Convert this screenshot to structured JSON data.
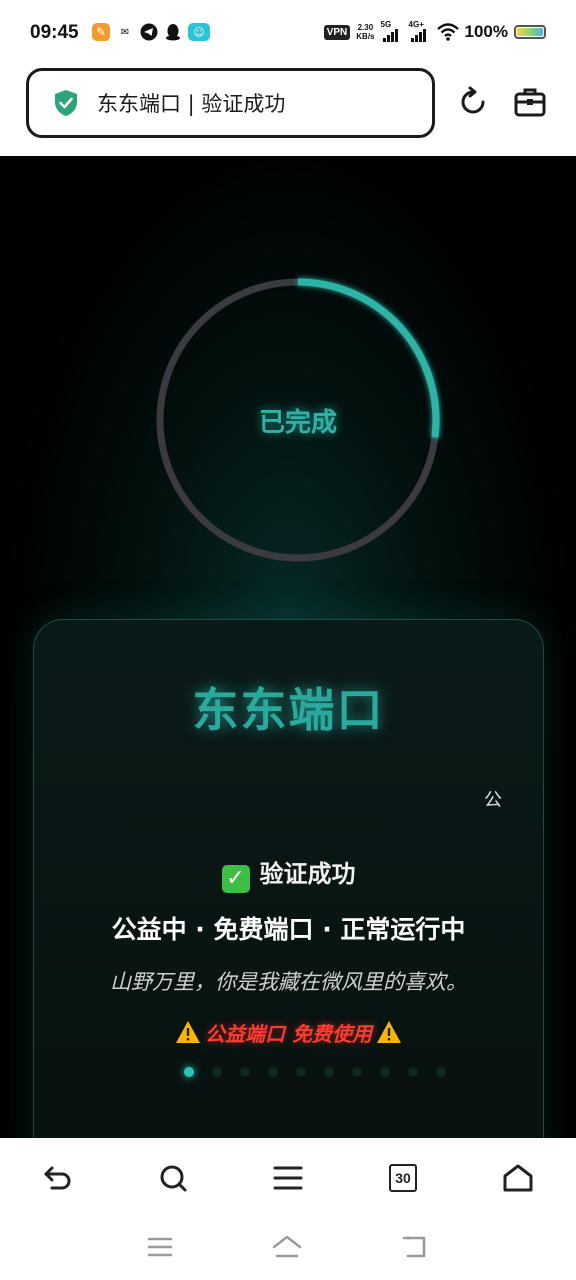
{
  "status_bar": {
    "time": "09:45",
    "vpn": "VPN",
    "speed_value": "2.30",
    "speed_unit": "KB/s",
    "net1": "5G",
    "net2": "4G+",
    "battery": "100%"
  },
  "address_bar": {
    "url_text": "东东端口 | 验证成功"
  },
  "progress": {
    "label": "已完成",
    "fraction": 0.27,
    "track_color": "#3a3a40",
    "accent_color": "#2fb3a6"
  },
  "card": {
    "title": "东东端口",
    "marquee": "公",
    "verified_text": "验证成功",
    "status_line": "公益中 · 免费端口 · 正常运行中",
    "quote": "山野万里，你是我藏在微风里的喜欢。",
    "warning": "公益端口 免费使用",
    "warning_color": "#ff3b30"
  },
  "toolbar": {
    "tab_count": "30"
  }
}
